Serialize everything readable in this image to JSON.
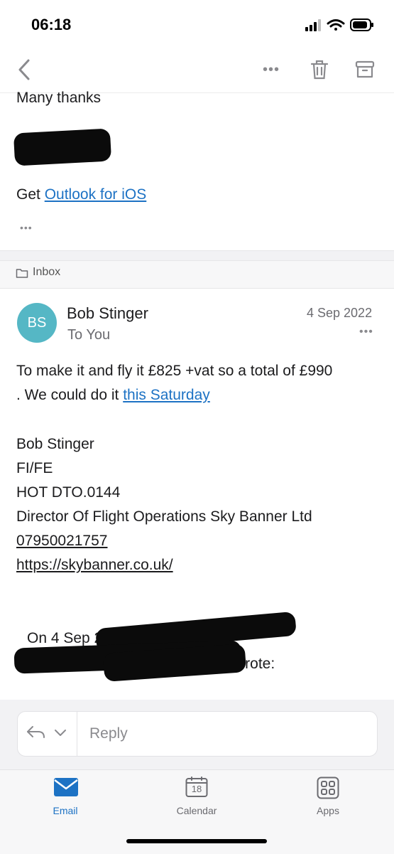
{
  "status_bar": {
    "time": "06:18",
    "icons": [
      "signal-icon",
      "wifi-icon",
      "battery-icon"
    ]
  },
  "toolbar": {
    "back_icon": "chevron-left-icon",
    "more_label": "•••",
    "delete_icon": "trash-icon",
    "archive_icon": "archive-icon"
  },
  "previous_message": {
    "closing": "Many thanks",
    "get_prefix": "Get",
    "get_link": "Outlook for iOS",
    "more_label": "•••"
  },
  "folder": {
    "icon": "folder-icon",
    "label": "Inbox"
  },
  "message": {
    "avatar_initials": "BS",
    "avatar_color": "#55b7c5",
    "sender": "Bob Stinger",
    "recipient": "To You",
    "date": "4 Sep 2022",
    "more_label": "•••",
    "body_line1": "To make it and fly it £825 +vat so a total of £990",
    "body_line2_prefix": ". We could do it",
    "body_line2_link": "this Saturday",
    "signature": {
      "name": "Bob Stinger",
      "role": "FI/FE",
      "code": "HOT DTO.0144",
      "title": "Director Of Flight Operations Sky Banner Ltd",
      "phone": "07950021757",
      "website": "https://skybanner.co.uk/"
    },
    "quoted_line1": "On 4 Sep 2022 at 20:22, S",
    "quoted_line2": "wrote:"
  },
  "reply_bar": {
    "reply_icon": "reply-icon",
    "chevron_icon": "chevron-down-icon",
    "reply_placeholder": "Reply"
  },
  "tab_bar": {
    "tabs": [
      {
        "label": "Email",
        "icon": "email-icon",
        "active": true
      },
      {
        "label": "Calendar",
        "icon": "calendar-icon",
        "badge": "18",
        "active": false
      },
      {
        "label": "Apps",
        "icon": "apps-icon",
        "active": false
      }
    ],
    "accent_color": "#1d72c4"
  }
}
